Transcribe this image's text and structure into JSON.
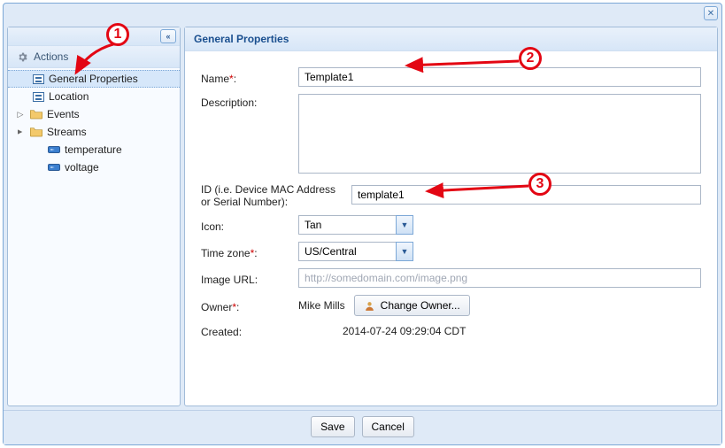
{
  "titlebar": {
    "close_tooltip": "Close"
  },
  "sidebar": {
    "collapse_glyph": "«",
    "actions_label": "Actions",
    "items": [
      {
        "label": "General Properties",
        "icon": "form-icon",
        "selected": true
      },
      {
        "label": "Location",
        "icon": "form-icon"
      },
      {
        "label": "Events",
        "icon": "folder-icon",
        "expander": "▷"
      },
      {
        "label": "Streams",
        "icon": "folder-icon",
        "expander": "▲",
        "children": [
          {
            "label": "temperature",
            "icon": "stream-icon"
          },
          {
            "label": "voltage",
            "icon": "stream-icon"
          }
        ]
      }
    ]
  },
  "main": {
    "header": "General Properties",
    "labels": {
      "name": "Name",
      "description": "Description:",
      "id": "ID (i.e. Device MAC Address or Serial Number):",
      "icon": "Icon:",
      "timezone": "Time zone",
      "image_url": "Image URL:",
      "owner": "Owner",
      "created": "Created:"
    },
    "values": {
      "name": "Template1",
      "description": "",
      "id": "template1",
      "icon": "Tan",
      "timezone": "US/Central",
      "image_url_placeholder": "http://somedomain.com/image.png",
      "owner": "Mike Mills",
      "change_owner_btn": "Change Owner...",
      "created": "2014-07-24 09:29:04 CDT"
    }
  },
  "footer": {
    "save": "Save",
    "cancel": "Cancel"
  },
  "annotations": {
    "n1": "1",
    "n2": "2",
    "n3": "3"
  }
}
